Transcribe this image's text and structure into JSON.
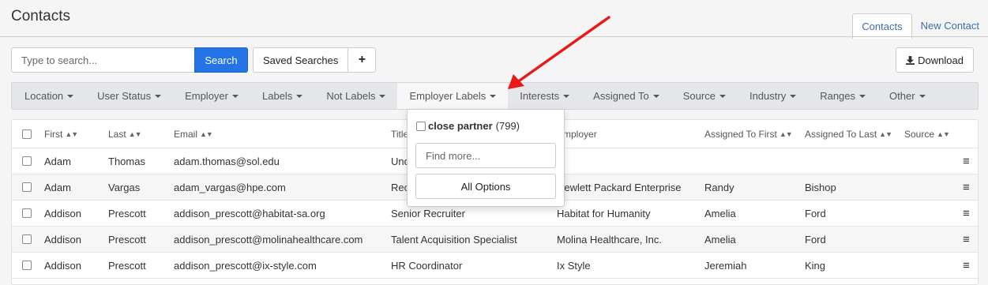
{
  "page": {
    "title": "Contacts"
  },
  "tabs": [
    {
      "label": "Contacts",
      "active": true
    },
    {
      "label": "New Contact",
      "active": false
    }
  ],
  "search": {
    "placeholder": "Type to search...",
    "button": "Search",
    "value": ""
  },
  "toolbar": {
    "saved_searches": "Saved Searches",
    "add": "+",
    "download": "Download",
    "download_icon": "download-icon"
  },
  "filters": [
    "Location",
    "User Status",
    "Employer",
    "Labels",
    "Not Labels",
    "Employer Labels",
    "Interests",
    "Assigned To",
    "Source",
    "Industry",
    "Ranges",
    "Other"
  ],
  "open_filter": "Employer Labels",
  "dropdown": {
    "option_label": "close partner",
    "option_count": "(799)",
    "find_placeholder": "Find more...",
    "all_options": "All Options"
  },
  "table": {
    "headers": [
      "First",
      "Last",
      "Email",
      "Title",
      "Employer",
      "Assigned To First",
      "Assigned To Last",
      "Source"
    ],
    "rows": [
      [
        "Adam",
        "Thomas",
        "adam.thomas@sol.edu",
        "Und",
        "",
        "",
        "",
        ""
      ],
      [
        "Adam",
        "Vargas",
        "adam_vargas@hpe.com",
        "Rec",
        "Hewlett Packard Enterprise",
        "Randy",
        "Bishop",
        ""
      ],
      [
        "Addison",
        "Prescott",
        "addison_prescott@habitat-sa.org",
        "Senior Recruiter",
        "Habitat for Humanity",
        "Amelia",
        "Ford",
        ""
      ],
      [
        "Addison",
        "Prescott",
        "addison_prescott@molinahealthcare.com",
        "Talent Acquisition Specialist",
        "Molina Healthcare, Inc.",
        "Amelia",
        "Ford",
        ""
      ],
      [
        "Addison",
        "Prescott",
        "addison_prescott@ix-style.com",
        "HR Coordinator",
        "Ix Style",
        "Jeremiah",
        "King",
        ""
      ]
    ]
  },
  "colors": {
    "accent": "#2474e5",
    "annotation_arrow": "#e8191b"
  }
}
